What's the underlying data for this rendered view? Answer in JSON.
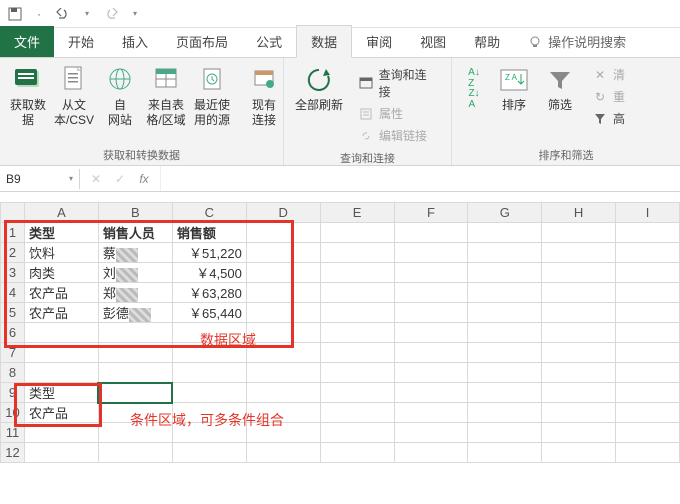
{
  "qat": {
    "save": "save",
    "undo": "undo",
    "redo": "redo"
  },
  "tabs": {
    "file": "文件",
    "home": "开始",
    "insert": "插入",
    "layout": "页面布局",
    "formulas": "公式",
    "data": "数据",
    "review": "审阅",
    "view": "视图",
    "help": "帮助",
    "tell": "操作说明搜索"
  },
  "ribbon": {
    "get": {
      "label": "获取和转换数据",
      "btns": {
        "get": "获取数\n据",
        "csv": "从文\n本/CSV",
        "web": "自\n网站",
        "table": "来自表\n格/区域",
        "recent": "最近使\n用的源",
        "exist": "现有\n连接"
      }
    },
    "conn": {
      "label": "查询和连接",
      "refresh": "全部刷新",
      "q": "查询和连接",
      "prop": "属性",
      "edit": "编辑链接"
    },
    "sort": {
      "label": "排序和筛选",
      "sort": "排序",
      "filter": "筛选",
      "clear": "清",
      "reapply": "重",
      "adv": "高"
    }
  },
  "namebox": "B9",
  "fx": "fx",
  "cols": [
    "A",
    "B",
    "C",
    "D",
    "E",
    "F",
    "G",
    "H",
    "I"
  ],
  "rows": [
    "1",
    "2",
    "3",
    "4",
    "5",
    "6",
    "7",
    "8",
    "9",
    "10",
    "11",
    "12"
  ],
  "hdr": {
    "a": "类型",
    "b": "销售人员",
    "c": "销售额"
  },
  "data": [
    {
      "a": "饮料",
      "b": "蔡",
      "c": "￥51,220"
    },
    {
      "a": "肉类",
      "b": "刘",
      "c": "￥4,500"
    },
    {
      "a": "农产品",
      "b": "郑",
      "c": "￥63,280"
    },
    {
      "a": "农产品",
      "b": "彭德",
      "c": "￥65,440"
    }
  ],
  "crit": {
    "a9": "类型",
    "a10": "农产品"
  },
  "ann": {
    "data": "数据区域",
    "crit": "条件区域，可多条件组合"
  }
}
